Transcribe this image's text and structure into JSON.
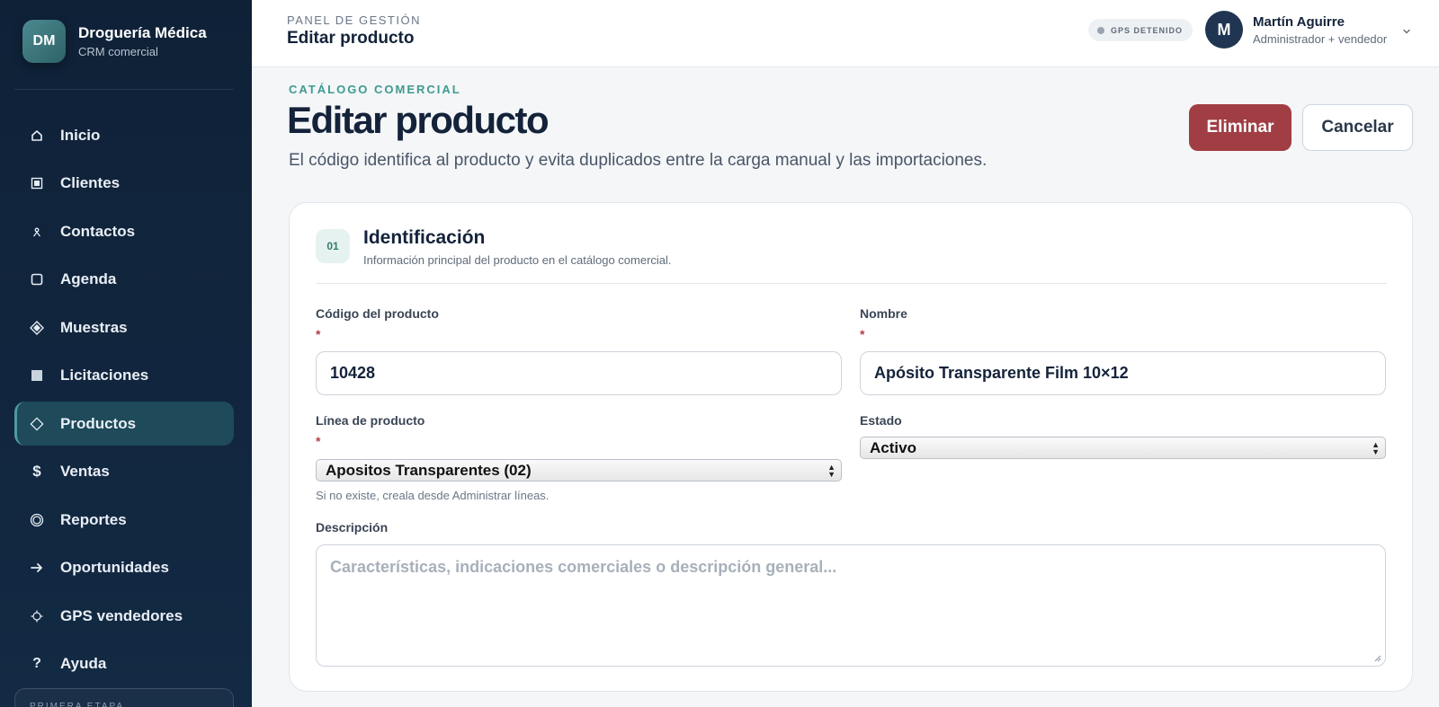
{
  "brand": {
    "initials": "DM",
    "name": "Droguería Médica",
    "subtitle": "CRM comercial"
  },
  "sidebar": {
    "items": [
      {
        "label": "Inicio",
        "icon": "home-icon"
      },
      {
        "label": "Clientes",
        "icon": "building-icon"
      },
      {
        "label": "Contactos",
        "icon": "person-icon"
      },
      {
        "label": "Agenda",
        "icon": "calendar-icon"
      },
      {
        "label": "Muestras",
        "icon": "diamond-icon"
      },
      {
        "label": "Licitaciones",
        "icon": "document-icon"
      },
      {
        "label": "Productos",
        "icon": "product-icon",
        "active": true
      },
      {
        "label": "Ventas",
        "icon": "dollar-icon"
      },
      {
        "label": "Reportes",
        "icon": "report-icon"
      },
      {
        "label": "Oportunidades",
        "icon": "arrow-right-icon"
      },
      {
        "label": "GPS vendedores",
        "icon": "gps-icon"
      },
      {
        "label": "Ayuda",
        "icon": "help-icon"
      }
    ],
    "bottom_card": "PRIMERA ETAPA"
  },
  "topbar": {
    "kicker": "PANEL DE GESTIÓN",
    "title": "Editar producto",
    "gps_status": "GPS DETENIDO",
    "user": {
      "initial": "M",
      "name": "Martín Aguirre",
      "role": "Administrador + vendedor"
    }
  },
  "main": {
    "kicker": "CATÁLOGO COMERCIAL",
    "title": "Editar producto",
    "subtitle": "El código identifica al producto y evita duplicados entre la carga manual y las importaciones.",
    "actions": {
      "delete_label": "Eliminar",
      "cancel_label": "Cancelar"
    }
  },
  "section": {
    "number": "01",
    "title": "Identificación",
    "subtitle": "Información principal del producto en el catálogo comercial."
  },
  "form": {
    "code": {
      "label": "Código del producto",
      "required_mark": "*",
      "value": "10428"
    },
    "name": {
      "label": "Nombre",
      "required_mark": "*",
      "value": "Apósito Transparente Film 10×12"
    },
    "line": {
      "label": "Línea de producto",
      "required_mark": "*",
      "value": "Apositos Transparentes (02)",
      "hint": "Si no existe, creala desde Administrar líneas."
    },
    "status": {
      "label": "Estado",
      "value": "Activo"
    },
    "description": {
      "label": "Descripción",
      "placeholder": "Características, indicaciones comerciales o descripción general..."
    }
  },
  "colors": {
    "sidebar_bg": "#0f2137",
    "accent_teal": "#3e9a8f",
    "danger": "#a03e44",
    "active_nav": "#1e4a5a"
  }
}
